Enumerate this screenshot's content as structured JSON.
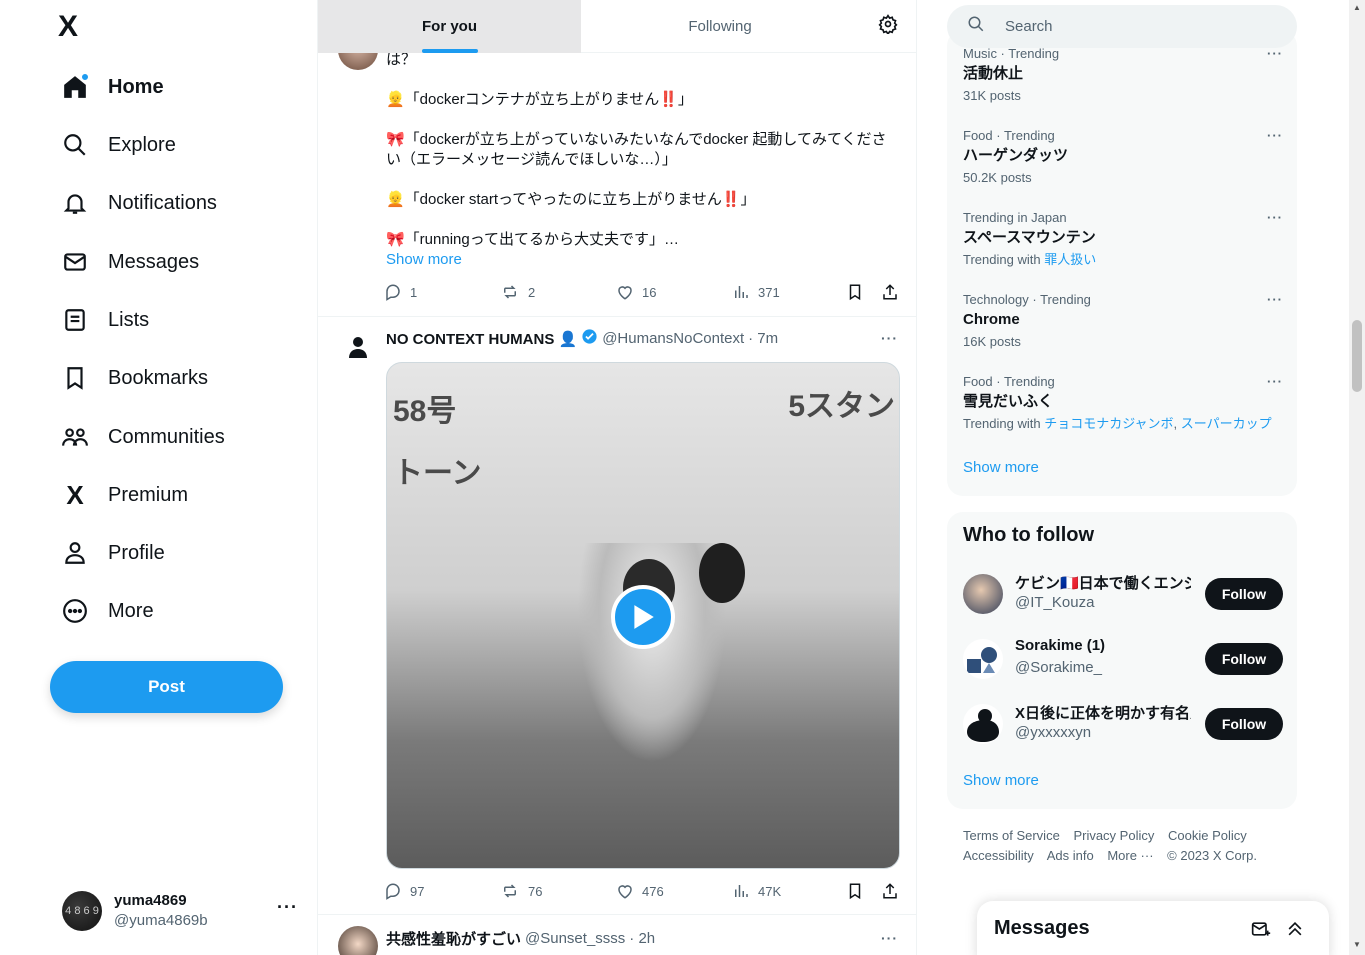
{
  "app": {
    "logo": "X",
    "accent": "#1d9bf0"
  },
  "nav": {
    "items": [
      {
        "label": "Home",
        "icon": "home-icon"
      },
      {
        "label": "Explore",
        "icon": "search-icon"
      },
      {
        "label": "Notifications",
        "icon": "bell-icon"
      },
      {
        "label": "Messages",
        "icon": "envelope-icon"
      },
      {
        "label": "Lists",
        "icon": "list-icon"
      },
      {
        "label": "Bookmarks",
        "icon": "bookmark-icon"
      },
      {
        "label": "Communities",
        "icon": "people-icon"
      },
      {
        "label": "Premium",
        "icon": "x-logo-icon"
      },
      {
        "label": "Profile",
        "icon": "person-icon"
      },
      {
        "label": "More",
        "icon": "more-circle-icon"
      }
    ],
    "post_label": "Post",
    "account": {
      "name": "yuma4869",
      "handle": "@yuma4869b",
      "avatar_text": "4 8 6 9"
    }
  },
  "timeline": {
    "tabs": [
      "For you",
      "Following"
    ],
    "tweet1": {
      "lines": [
        "は？",
        "👱「dockerコンテナが立ち上がりません‼️」",
        "🎀「dockerが立ち上がっていないみたいなんでdocker 起動してみてくださ",
        "い（エラーメッセージ読んでほしいな…）」",
        "👱「docker startってやったのに立ち上がりません‼️」",
        "🎀「runningって出てるから大丈夫です」…"
      ],
      "show_more": "Show more",
      "replies": "1",
      "reposts": "2",
      "likes": "16",
      "views": "371"
    },
    "tweet2": {
      "name": "NO CONTEXT HUMANS 👤",
      "handle": "@HumansNoContext",
      "time": "· 7m",
      "media_text_left": "58号\nトーン",
      "media_text_right": "5スタン",
      "replies": "97",
      "reposts": "76",
      "likes": "476",
      "views": "47K"
    },
    "tweet3": {
      "name": "共感性羞恥がすごい",
      "handle": "@Sunset_ssss",
      "time": "· 2h"
    }
  },
  "sidebar": {
    "search_placeholder": "Search",
    "trends": [
      {
        "category": "Music · Trending",
        "title": "活動休止",
        "count": "31K posts"
      },
      {
        "category": "Food · Trending",
        "title": "ハーゲンダッツ",
        "count": "50.2K posts"
      },
      {
        "category": "Trending in Japan",
        "title": "スペースマウンテン",
        "with_label": "Trending with",
        "with": [
          "罪人扱い"
        ]
      },
      {
        "category": "Technology · Trending",
        "title": "Chrome",
        "count": "16K posts"
      },
      {
        "category": "Food · Trending",
        "title": "雪見だいふく",
        "with_label": "Trending with",
        "with": [
          "チョコモナカジャンボ",
          "スーパーカップ"
        ]
      }
    ],
    "trends_show_more": "Show more",
    "who_to_follow": {
      "title": "Who to follow",
      "accounts": [
        {
          "name": "ケビン🇫🇷日本で働くエンジニア",
          "handle": "@IT_Kouza",
          "button": "Follow"
        },
        {
          "name": "Sorakime (1)",
          "handle": "@Sorakime_",
          "button": "Follow"
        },
        {
          "name": "X日後に正体を明かす有名人",
          "handle": "@yxxxxxyn",
          "button": "Follow"
        }
      ],
      "show_more": "Show more"
    },
    "footer": [
      "Terms of Service",
      "Privacy Policy",
      "Cookie Policy",
      "Accessibility",
      "Ads info",
      "More ···",
      "© 2023 X Corp."
    ]
  },
  "messages_drawer": {
    "title": "Messages"
  }
}
